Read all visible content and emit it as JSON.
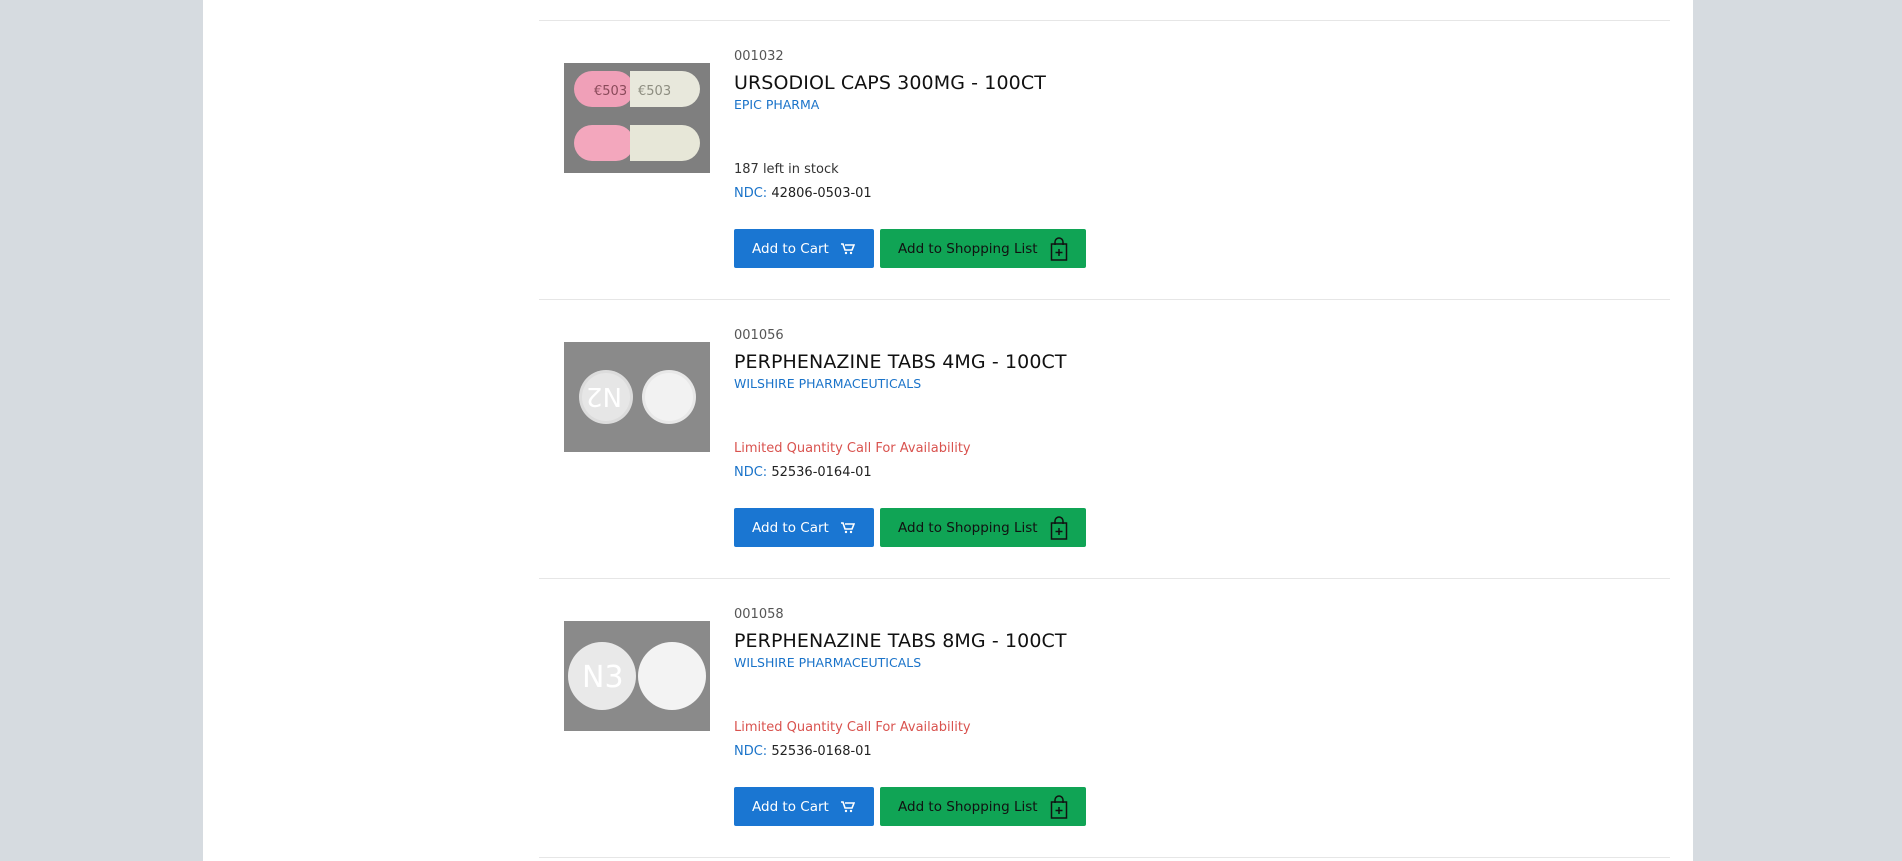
{
  "products": [
    {
      "sku": "001032",
      "title": "URSODIOL CAPS 300MG - 100CT",
      "manufacturer": "EPIC PHARMA",
      "stock_text": "187 left in stock",
      "stock_limited": false,
      "ndc_label": "NDC:",
      "ndc": "42806-0503-01",
      "image_imprint": "€503",
      "cart_label": "Add to Cart",
      "list_label": "Add to Shopping List"
    },
    {
      "sku": "001056",
      "title": "PERPHENAZINE TABS 4MG - 100CT",
      "manufacturer": "WILSHIRE PHARMACEUTICALS",
      "stock_text": "Limited Quantity Call For Availability",
      "stock_limited": true,
      "ndc_label": "NDC:",
      "ndc": "52536-0164-01",
      "image_imprint": "N2",
      "cart_label": "Add to Cart",
      "list_label": "Add to Shopping List"
    },
    {
      "sku": "001058",
      "title": "PERPHENAZINE TABS 8MG - 100CT",
      "manufacturer": "WILSHIRE PHARMACEUTICALS",
      "stock_text": "Limited Quantity Call For Availability",
      "stock_limited": true,
      "ndc_label": "NDC:",
      "ndc": "52536-0168-01",
      "image_imprint": "N3",
      "cart_label": "Add to Cart",
      "list_label": "Add to Shopping List"
    }
  ],
  "colors": {
    "cart_button": "#1a76d2",
    "list_button": "#10a455",
    "manufacturer_link": "#1a73c9",
    "limited_stock": "#d9534f"
  },
  "icons": {
    "cart": "shopping-cart-icon",
    "list": "shopping-bag-plus-icon"
  }
}
